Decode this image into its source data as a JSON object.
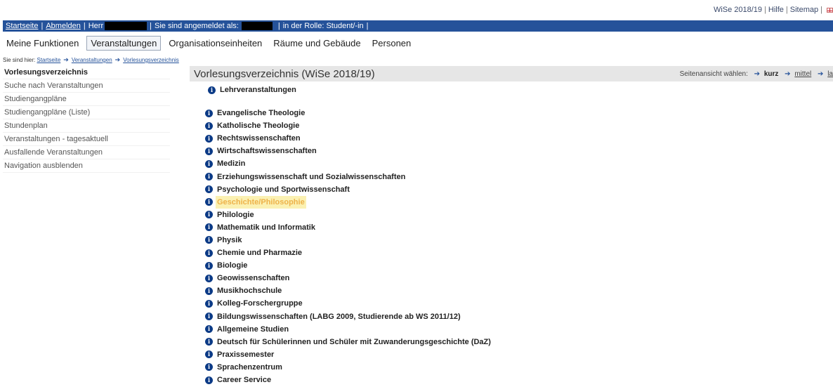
{
  "util": {
    "semester": "WiSe 2018/19",
    "help": "Hilfe",
    "sitemap": "Sitemap"
  },
  "bluebar": {
    "home": "Startseite",
    "logout": "Abmelden",
    "mr": "Herr",
    "logged_in_as": "Sie sind angemeldet als:",
    "role": "in der Rolle: Student/-in"
  },
  "nav": {
    "items": [
      "Meine Funktionen",
      "Veranstaltungen",
      "Organisationseinheiten",
      "Räume und Gebäude",
      "Personen"
    ]
  },
  "breadcrumb": {
    "prefix": "Sie sind hier:",
    "items": [
      "Startseite",
      "Veranstaltungen",
      "Vorlesungsverzeichnis"
    ]
  },
  "sidebar": {
    "items": [
      "Vorlesungsverzeichnis",
      "Suche nach Veranstaltungen",
      "Studiengangpläne",
      "Studiengangpläne (Liste)",
      "Stundenplan",
      "Veranstaltungen - tagesaktuell",
      "Ausfallende Veranstaltungen",
      "Navigation ausblenden"
    ]
  },
  "main": {
    "title": "Vorlesungsverzeichnis (WiSe 2018/19)",
    "view_label": "Seitenansicht wählen:",
    "view_short": "kurz",
    "view_medium": "mittel",
    "view_long": "la",
    "root": "Lehrveranstaltungen",
    "items": [
      "Evangelische Theologie",
      "Katholische Theologie",
      "Rechtswissenschaften",
      "Wirtschaftswissenschaften",
      "Medizin",
      "Erziehungswissenschaft und Sozialwissenschaften",
      "Psychologie und Sportwissenschaft",
      "Geschichte/Philosophie",
      "Philologie",
      "Mathematik und Informatik",
      "Physik",
      "Chemie und Pharmazie",
      "Biologie",
      "Geowissenschaften",
      "Musikhochschule",
      "Kolleg-Forschergruppe",
      "Bildungswissenschaften (LABG 2009, Studierende ab WS 2011/12)",
      "Allgemeine Studien",
      "Deutsch für Schülerinnen und Schüler mit Zuwanderungsgeschichte (DaZ)",
      "Praxissemester",
      "Sprachenzentrum",
      "Career Service"
    ],
    "highlighted_item": "Geschichte/Philosophie"
  },
  "icons": {
    "info": "i",
    "arrow": "➔"
  },
  "colors": {
    "bar_blue": "#25529a",
    "info_icon": "#0b3a86",
    "highlight_bg": "#fbf1b2",
    "highlight_text": "#eeb24a"
  }
}
